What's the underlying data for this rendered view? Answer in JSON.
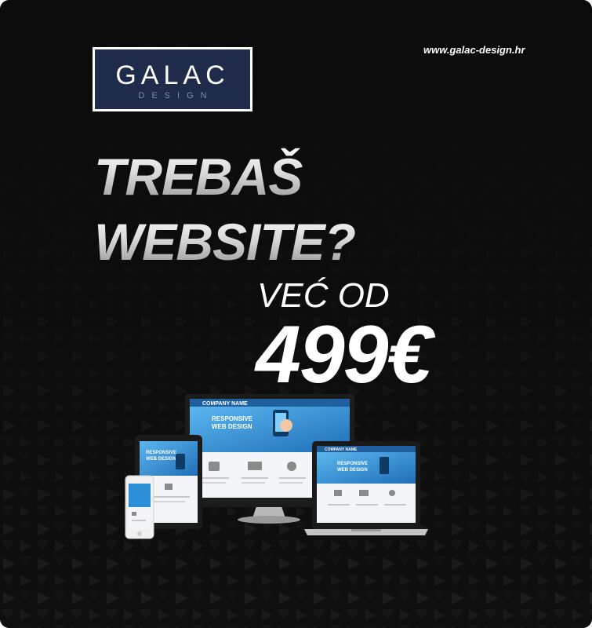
{
  "logo": {
    "name": "GALAC",
    "sub": "DESIGN"
  },
  "website_url": "www.galac-design.hr",
  "headline": {
    "line1": "TREBAŠ",
    "line2": "WEBSITE?"
  },
  "price_prefix": "VEĆ OD",
  "price": "499€",
  "mockup": {
    "company_name": "COMPANY NAME",
    "hero_line1": "RESPONSIVE",
    "hero_line2": "WEB DESIGN"
  },
  "colors": {
    "background": "#0b0b0b",
    "logo_bg": "#1f2b4a",
    "screen_blue": "#2d8fd8"
  }
}
